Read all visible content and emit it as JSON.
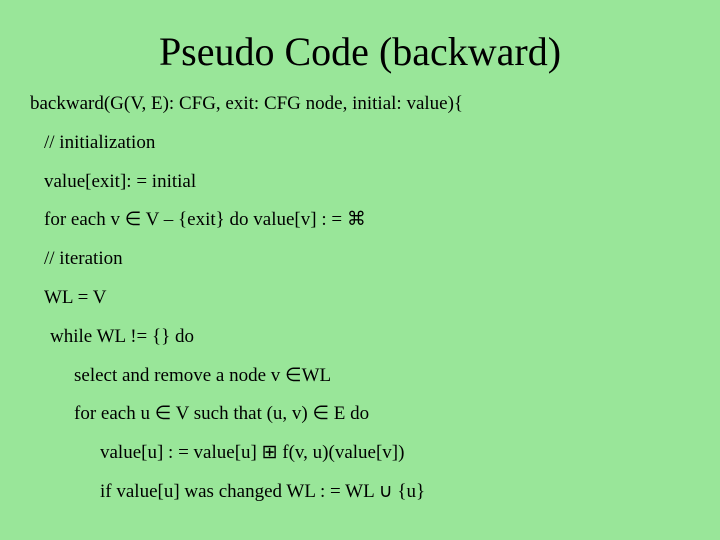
{
  "title": "Pseudo Code (backward)",
  "lines": {
    "l0": "backward(G(V, E): CFG, exit: CFG node, initial: value){",
    "l1": "// initialization",
    "l2": "value[exit]: = initial",
    "l3": "for each v ∈ V – {exit} do value[v] : = ⌘",
    "l4": "// iteration",
    "l5": "WL = V",
    "l6": "while WL != {} do",
    "l7": "select and remove a node v ∈WL",
    "l8": "for each u ∈ V such that (u, v) ∈ E do",
    "l9": "value[u] : = value[u] ⊞ f(v, u)(value[v])",
    "l10": "if value[u] was changed WL : = WL ∪ {u}"
  }
}
